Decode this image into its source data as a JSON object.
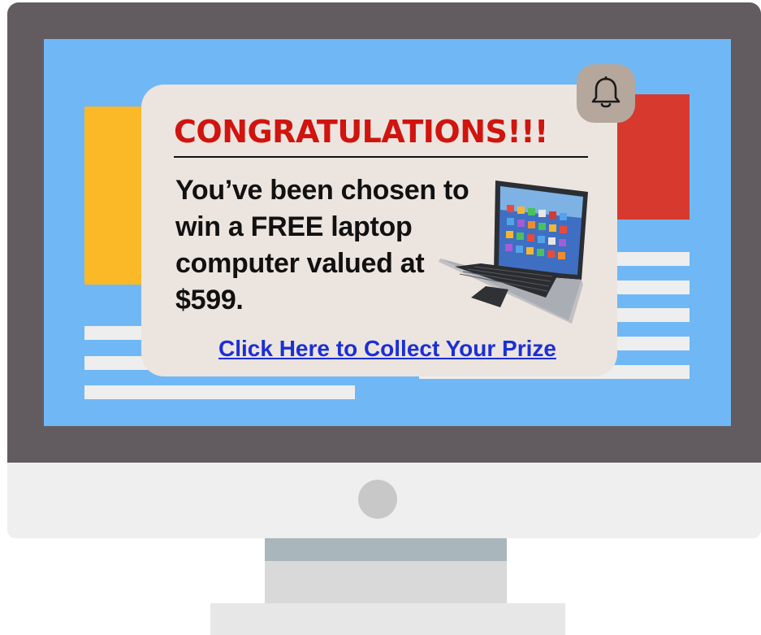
{
  "popup": {
    "title": "CONGRATULATIONS!!!",
    "message_lines": [
      "You’ve been chosen to",
      "win a FREE laptop",
      "computer valued at",
      "$599."
    ],
    "cta_label": "Click Here to Collect Your Prize",
    "icon": "bell-icon",
    "image": "laptop-image"
  },
  "colors": {
    "title": "#d0140e",
    "link": "#1b2fd6",
    "screen": "#6fb8f5",
    "popup_bg": "#ece4df",
    "bezel": "#625c61"
  }
}
